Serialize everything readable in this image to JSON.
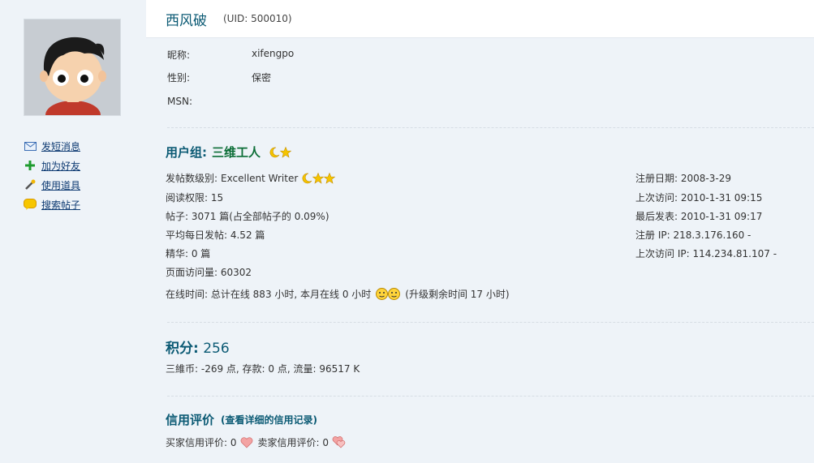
{
  "profile": {
    "username": "西风破",
    "uid_text": "(UID: 500010)",
    "nickname_label": "昵称:",
    "nickname": "xifengpo",
    "gender_label": "性别:",
    "gender": "保密",
    "msn_label": "MSN:"
  },
  "sidebar": {
    "items": [
      {
        "label": "发短消息",
        "icon": "envelope-icon"
      },
      {
        "label": "加为好友",
        "icon": "plus-icon"
      },
      {
        "label": "使用道具",
        "icon": "wand-icon"
      },
      {
        "label": "搜索帖子",
        "icon": "search-bubble-icon"
      }
    ]
  },
  "group": {
    "label": "用户组:",
    "name": "三维工人",
    "icons": [
      "moon-icon",
      "star-icon"
    ]
  },
  "stats": {
    "post_level_label": "发帖数级别:",
    "post_level": "Excellent Writer",
    "read_perm": "阅读权限: 15",
    "posts": "帖子: 3071 篇(占全部帖子的 0.09%)",
    "daily_posts": "平均每日发帖: 4.52 篇",
    "digest": "精华: 0 篇",
    "page_views": "页面访问量: 60302",
    "online_time": "在线时间: 总计在线  883 小时, 本月在线  0 小时",
    "upgrade": "(升级剩余时间  17 小时)"
  },
  "dates": {
    "register_date": "注册日期: 2008-3-29",
    "last_visit": "上次访问: 2010-1-31 09:15",
    "last_post": "最后发表: 2010-1-31 09:17",
    "register_ip": "注册  IP: 218.3.176.160 -",
    "last_visit_ip": "上次访问  IP: 114.234.81.107 -"
  },
  "credits": {
    "title": "积分:",
    "value": "256",
    "detail": "三維币: -269 点, 存款: 0 点, 流量: 96517 K"
  },
  "reputation": {
    "title": "信用评价",
    "link": "(查看详细的信用记录)",
    "buyer": "买家信用评价: 0",
    "seller": "卖家信用评价: 0"
  },
  "colors": {
    "background": "#eef3f8",
    "title_teal": "#0b5a74",
    "group_green": "#0b6d36",
    "link_blue": "#0d3a72"
  }
}
